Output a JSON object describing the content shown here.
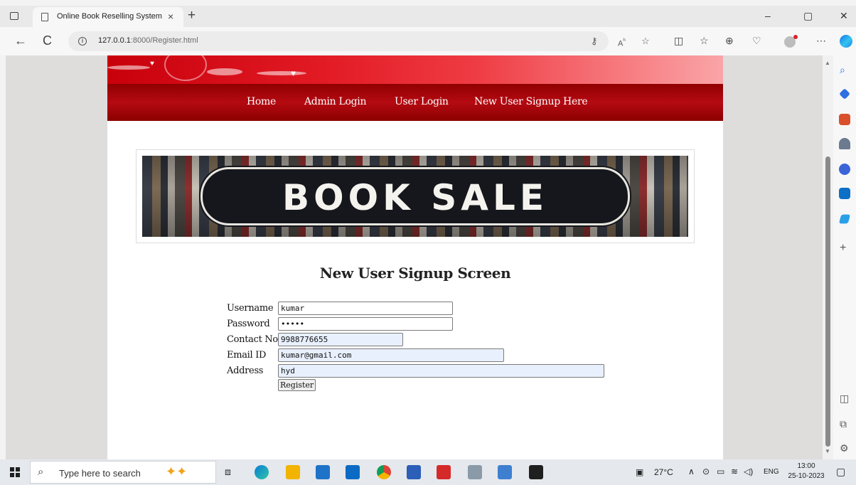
{
  "browser": {
    "tab_title": "Online Book Reselling System",
    "tab_close": "×",
    "new_tab": "+",
    "url_host": "127.0.0.1",
    "url_rest": ":8000/Register.html",
    "window_controls": {
      "minimize": "–",
      "restore": "▢",
      "close": "✕"
    },
    "nav": {
      "back": "←",
      "refresh": "C"
    }
  },
  "site": {
    "nav_items": [
      "Home",
      "Admin Login",
      "User Login",
      "New User Signup Here"
    ],
    "banner_text": "BOOK SALE"
  },
  "form": {
    "heading": "New User Signup Screen",
    "fields": {
      "username": {
        "label": "Username",
        "value": "kumar"
      },
      "password": {
        "label": "Password",
        "value": "•••••"
      },
      "contact": {
        "label": "Contact No",
        "value": "9988776655"
      },
      "email": {
        "label": "Email ID",
        "value": "kumar@gmail.com"
      },
      "address": {
        "label": "Address",
        "value": "hyd"
      }
    },
    "submit_label": "Register"
  },
  "taskbar": {
    "search_placeholder": "Type here to search",
    "weather": "27°C",
    "language": "ENG",
    "time": "13:00",
    "date": "25-10-2023"
  }
}
